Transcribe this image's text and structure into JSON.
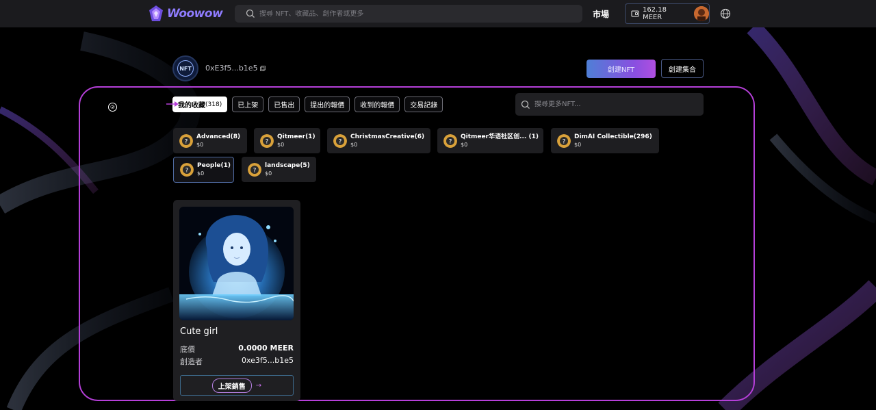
{
  "header": {
    "logo_text": "Woowow",
    "search_placeholder": "搜尋 NFT、收藏品、創作者或更多",
    "market_label": "市場",
    "wallet_balance": "162.18 MEER",
    "icons": [
      "search-icon",
      "wallet-icon",
      "globe-icon"
    ]
  },
  "profile": {
    "avatar_text": "NFT",
    "address": "0xE3f5...b1e5",
    "create_nft_label": "創建NFT",
    "create_collection_label": "創建集合"
  },
  "step_marker": "②",
  "tabs": [
    {
      "label": "我的收藏",
      "count": "(318)",
      "active": true
    },
    {
      "label": "已上架"
    },
    {
      "label": "已售出"
    },
    {
      "label": "提出的報價"
    },
    {
      "label": "收到的報價"
    },
    {
      "label": "交易記錄"
    }
  ],
  "nft_search_placeholder": "搜尋更多NFT...",
  "collections": [
    {
      "name": "Advanced(8)",
      "price": "$0"
    },
    {
      "name": "Qitmeer(1)",
      "price": "$0"
    },
    {
      "name": "ChristmasCreative(6)",
      "price": "$0"
    },
    {
      "name": "Qitmeer华语社区创... (1)",
      "price": "$0"
    },
    {
      "name": "DimAI Collectible(296)",
      "price": "$0"
    },
    {
      "name": "People(1)",
      "price": "$0",
      "selected": true
    },
    {
      "name": "landscape(5)",
      "price": "$0"
    }
  ],
  "card": {
    "title": "Cute girl",
    "floor_label": "底價",
    "floor_value": "0.0000 MEER",
    "creator_label": "創造者",
    "creator_value": "0xe3f5...b1e5",
    "list_button_label": "上架銷售",
    "list_button_arrow": "→"
  },
  "colors": {
    "frame_border": "#b53fd8",
    "accent_gradient_start": "#4f7fd6",
    "accent_gradient_end": "#b04fe0",
    "chip_bg": "#1e1e21"
  }
}
